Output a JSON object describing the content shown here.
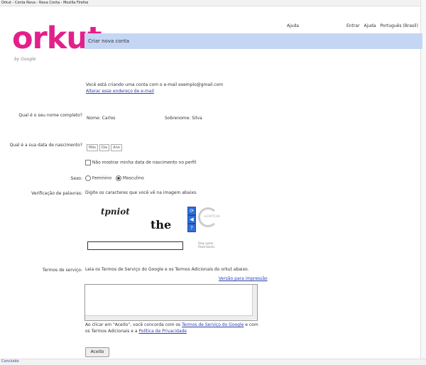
{
  "browser": {
    "title_bar": "Orkut - Conta Nova - Nova Conta - Mozilla Firefox",
    "status_text": "Concluído"
  },
  "header": {
    "logo_text": "orkut",
    "by_google": "by Google",
    "link_help": "Ajuda",
    "links_right": [
      "Entrar",
      "Ajuda",
      "Português (Brasil)"
    ]
  },
  "banner": {
    "title": "Criar nova conta"
  },
  "intro": {
    "line1": "Você está criando uma conta com o e-mail exemplo@gmail.com",
    "line2_link": "Alterar esse endereço de e-mail"
  },
  "form": {
    "name_label": "Qual é o seu nome completo?",
    "first_name_label": "Nome:",
    "first_name_value": "Carlos",
    "last_name_label": "Sobrenome:",
    "last_name_value": "Silva",
    "birthday_label": "Qual é a sua data de nascimento?",
    "dropdown_month": "Mês",
    "dropdown_day": "Dia",
    "dropdown_year": "Ano",
    "hide_birthday_text": "Não mostrar minha data de nascimento no perfil",
    "gender_label": "Sexo:",
    "gender_female": "Feminino",
    "gender_male": "Masculino",
    "verify_label": "Verificação de palavras:",
    "verify_hint": "Digite os caracteres que você vê na imagem abaixo.",
    "captcha_word1": "tpniot",
    "captcha_word2": "the",
    "captcha_side_text": "reCAPTCHA",
    "captcha_stop_spam": "Stop spam. Read books.",
    "terms_label": "Termos de serviço:",
    "terms_intro": "Leia os Termos de Serviço do Google e os Termos Adicionais do orkut abaixo.",
    "terms_print_link": "Versão para impressão",
    "accept_text_1": "Ao clicar em \"Aceito\", você concorda com os",
    "accept_link_1": "Termos de Serviço do Google",
    "accept_text_2": "e com os Termos Adicionais e a",
    "accept_link_2": "Política de Privacidade",
    "apply_button": "Aceito"
  }
}
